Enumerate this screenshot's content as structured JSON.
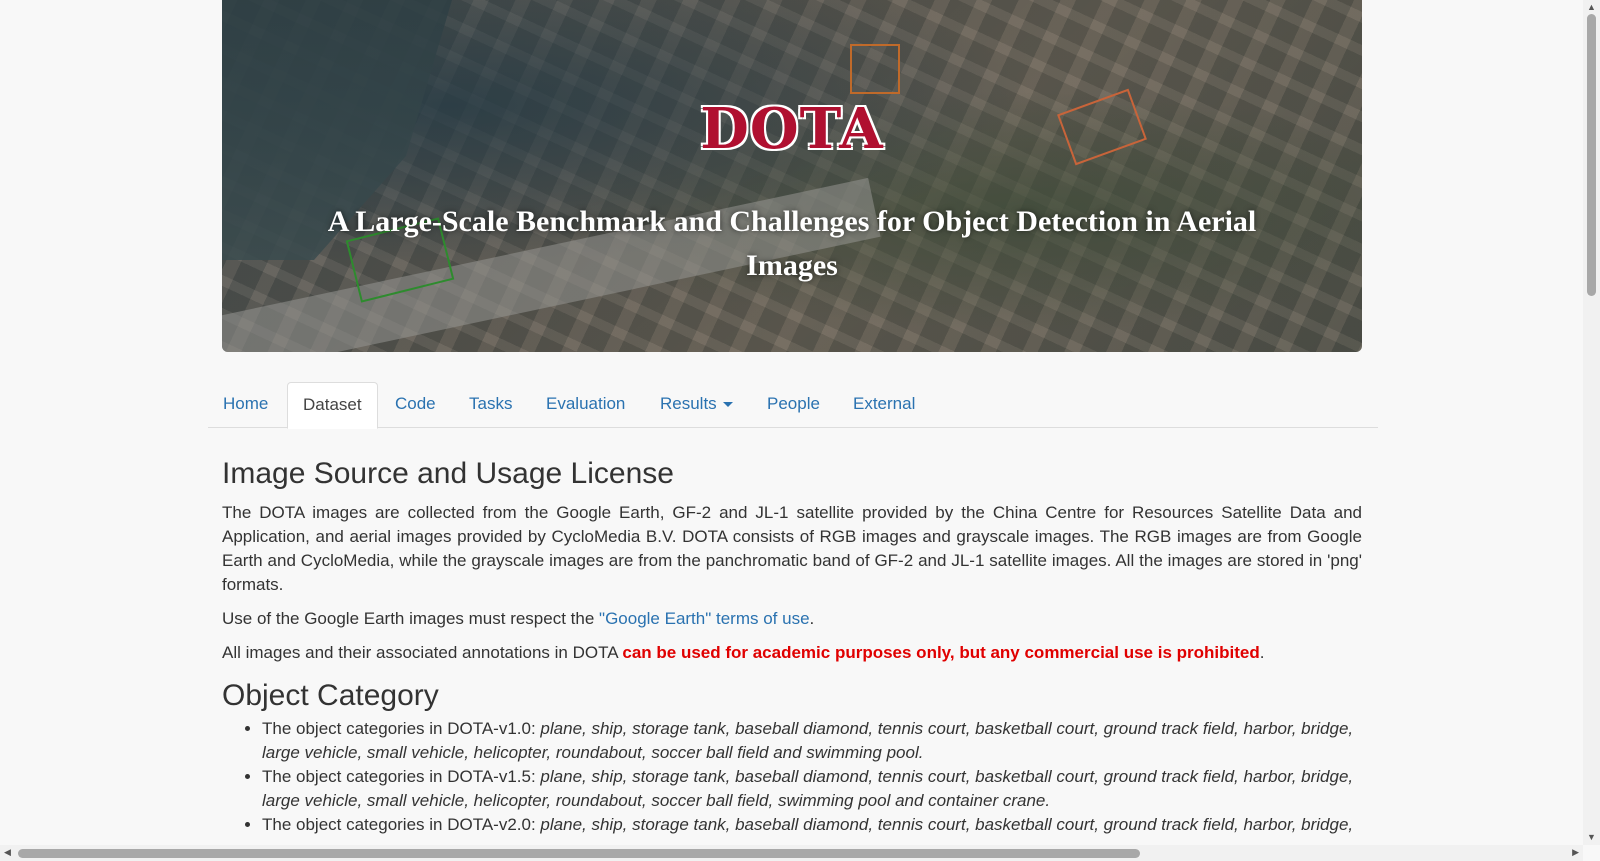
{
  "banner": {
    "title": "DOTA",
    "subtitle": "A Large-Scale Benchmark and Challenges for Object Detection in Aerial Images"
  },
  "nav": {
    "tabs": [
      "Home",
      "Dataset",
      "Code",
      "Tasks",
      "Evaluation",
      "Results",
      "People",
      "External"
    ],
    "active": "Dataset"
  },
  "license": {
    "heading": "Image Source and Usage License",
    "para1": "The DOTA images are collected from the Google Earth, GF-2 and JL-1 satellite provided by the China Centre for Resources Satellite Data and Application, and aerial images provided by CycloMedia B.V. DOTA consists of RGB images and grayscale images. The RGB images are from Google Earth and CycloMedia, while the grayscale images are from the panchromatic band of GF-2 and JL-1 satellite images. All the images are stored in 'png' formats.",
    "para2_prefix": "Use of the Google Earth images must respect the ",
    "para2_link": "\"Google Earth\" terms of use",
    "para2_suffix": ".",
    "para3_prefix": "All images and their associated annotations in DOTA ",
    "para3_warning": "can be used for academic purposes only, but any commercial use is prohibited",
    "para3_suffix": "."
  },
  "category": {
    "heading": "Object Category",
    "items": [
      {
        "prefix": "The object categories in DOTA-v1.0: ",
        "cats": "plane, ship, storage tank, baseball diamond, tennis court, basketball court, ground track field, harbor, bridge, large vehicle, small vehicle, helicopter, roundabout, soccer ball field and swimming pool."
      },
      {
        "prefix": "The object categories in DOTA-v1.5: ",
        "cats": "plane, ship, storage tank, baseball diamond, tennis court, basketball court, ground track field, harbor, bridge, large vehicle, small vehicle, helicopter, roundabout, soccer ball field, swimming pool and container crane."
      },
      {
        "prefix": "The object categories in DOTA-v2.0: ",
        "cats": "plane, ship, storage tank, baseball diamond, tennis court, basketball court, ground track field, harbor, bridge,"
      }
    ]
  },
  "colors": {
    "link": "#2a72b0",
    "warning": "#e00000",
    "title_red": "#b01030"
  }
}
